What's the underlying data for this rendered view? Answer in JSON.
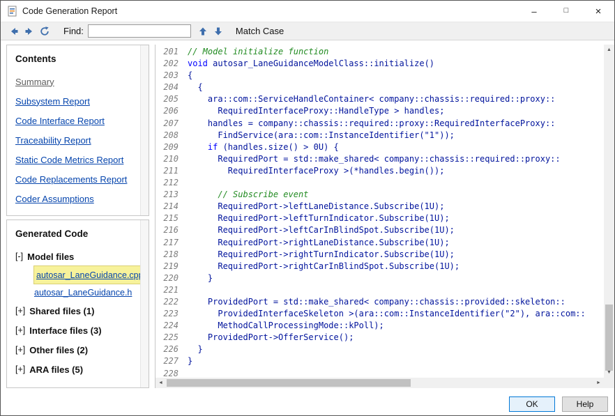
{
  "window": {
    "title": "Code Generation Report",
    "controls": {
      "minimize": "–",
      "maximize": "□",
      "close": "×"
    }
  },
  "toolbar": {
    "find_label": "Find:",
    "find_value": "",
    "match_case_label": "Match Case"
  },
  "sidebar": {
    "contents_heading": "Contents",
    "links": [
      {
        "label": "Summary",
        "visited": true
      },
      {
        "label": "Subsystem Report",
        "visited": false
      },
      {
        "label": "Code Interface Report",
        "visited": false
      },
      {
        "label": "Traceability Report",
        "visited": false
      },
      {
        "label": "Static Code Metrics Report",
        "visited": false
      },
      {
        "label": "Code Replacements Report",
        "visited": false
      },
      {
        "label": "Coder Assumptions",
        "visited": false
      }
    ],
    "generated_heading": "Generated Code",
    "tree": [
      {
        "expander": "[-]",
        "label": "Model files",
        "children": [
          {
            "label": "autosar_LaneGuidance.cpp",
            "highlighted": true
          },
          {
            "label": "autosar_LaneGuidance.h",
            "highlighted": false
          }
        ]
      },
      {
        "expander": "[+]",
        "label": "Shared files (1)",
        "children": []
      },
      {
        "expander": "[+]",
        "label": "Interface files (3)",
        "children": []
      },
      {
        "expander": "[+]",
        "label": "Other files (2)",
        "children": []
      },
      {
        "expander": "[+]",
        "label": "ARA files (5)",
        "children": []
      }
    ]
  },
  "code": {
    "lines": [
      {
        "n": "201",
        "s": [
          [
            "c",
            "// Model initialize function"
          ]
        ]
      },
      {
        "n": "202",
        "s": [
          [
            "k",
            "void"
          ],
          [
            "p",
            " autosar_LaneGuidanceModelClass::initialize()"
          ]
        ]
      },
      {
        "n": "203",
        "s": [
          [
            "p",
            "{"
          ]
        ]
      },
      {
        "n": "204",
        "s": [
          [
            "p",
            "  {"
          ]
        ]
      },
      {
        "n": "205",
        "s": [
          [
            "p",
            "    ara::com::ServiceHandleContainer< company::chassis::required::proxy::"
          ]
        ]
      },
      {
        "n": "206",
        "s": [
          [
            "p",
            "      RequiredInterfaceProxy::HandleType > handles;"
          ]
        ]
      },
      {
        "n": "207",
        "s": [
          [
            "p",
            "    handles = company::chassis::required::proxy::RequiredInterfaceProxy::"
          ]
        ]
      },
      {
        "n": "208",
        "s": [
          [
            "p",
            "      FindService(ara::com::InstanceIdentifier(\"1\"));"
          ]
        ]
      },
      {
        "n": "209",
        "s": [
          [
            "p",
            "    "
          ],
          [
            "k",
            "if"
          ],
          [
            "p",
            " (handles.size() > 0U) {"
          ]
        ]
      },
      {
        "n": "210",
        "s": [
          [
            "p",
            "      RequiredPort = std::make_shared< company::chassis::required::proxy::"
          ]
        ]
      },
      {
        "n": "211",
        "s": [
          [
            "p",
            "        RequiredInterfaceProxy >(*handles.begin());"
          ]
        ]
      },
      {
        "n": "212",
        "s": []
      },
      {
        "n": "213",
        "s": [
          [
            "p",
            "      "
          ],
          [
            "c",
            "// Subscribe event"
          ]
        ]
      },
      {
        "n": "214",
        "s": [
          [
            "p",
            "      RequiredPort->leftLaneDistance.Subscribe(1U);"
          ]
        ]
      },
      {
        "n": "215",
        "s": [
          [
            "p",
            "      RequiredPort->leftTurnIndicator.Subscribe(1U);"
          ]
        ]
      },
      {
        "n": "216",
        "s": [
          [
            "p",
            "      RequiredPort->leftCarInBlindSpot.Subscribe(1U);"
          ]
        ]
      },
      {
        "n": "217",
        "s": [
          [
            "p",
            "      RequiredPort->rightLaneDistance.Subscribe(1U);"
          ]
        ]
      },
      {
        "n": "218",
        "s": [
          [
            "p",
            "      RequiredPort->rightTurnIndicator.Subscribe(1U);"
          ]
        ]
      },
      {
        "n": "219",
        "s": [
          [
            "p",
            "      RequiredPort->rightCarInBlindSpot.Subscribe(1U);"
          ]
        ]
      },
      {
        "n": "220",
        "s": [
          [
            "p",
            "    }"
          ]
        ]
      },
      {
        "n": "221",
        "s": []
      },
      {
        "n": "222",
        "s": [
          [
            "p",
            "    ProvidedPort = std::make_shared< company::chassis::provided::skeleton::"
          ]
        ]
      },
      {
        "n": "223",
        "s": [
          [
            "p",
            "      ProvidedInterfaceSkeleton >(ara::com::InstanceIdentifier(\"2\"), ara::com::"
          ]
        ]
      },
      {
        "n": "224",
        "s": [
          [
            "p",
            "      MethodCallProcessingMode::kPoll);"
          ]
        ]
      },
      {
        "n": "225",
        "s": [
          [
            "p",
            "    ProvidedPort->OfferService();"
          ]
        ]
      },
      {
        "n": "226",
        "s": [
          [
            "p",
            "  }"
          ]
        ]
      },
      {
        "n": "227",
        "s": [
          [
            "p",
            "}"
          ]
        ]
      },
      {
        "n": "228",
        "s": []
      }
    ]
  },
  "scrollbar": {
    "up_icon": "▲",
    "down_icon": "▼",
    "left_icon": "◄",
    "right_icon": "►"
  },
  "footer": {
    "ok_label": "OK",
    "help_label": "Help"
  },
  "colors": {
    "accent_blue": "#3F6FAD",
    "link": "#0645AD",
    "visited_link": "#5F5F5F",
    "code_plain": "#00139C",
    "code_keyword": "#0000FF",
    "code_comment": "#228B22",
    "line_number": "#7D7D7D",
    "highlight_bg": "#F7F29B",
    "highlight_border": "#D9D074",
    "ok_focus_border": "#0078D7"
  }
}
